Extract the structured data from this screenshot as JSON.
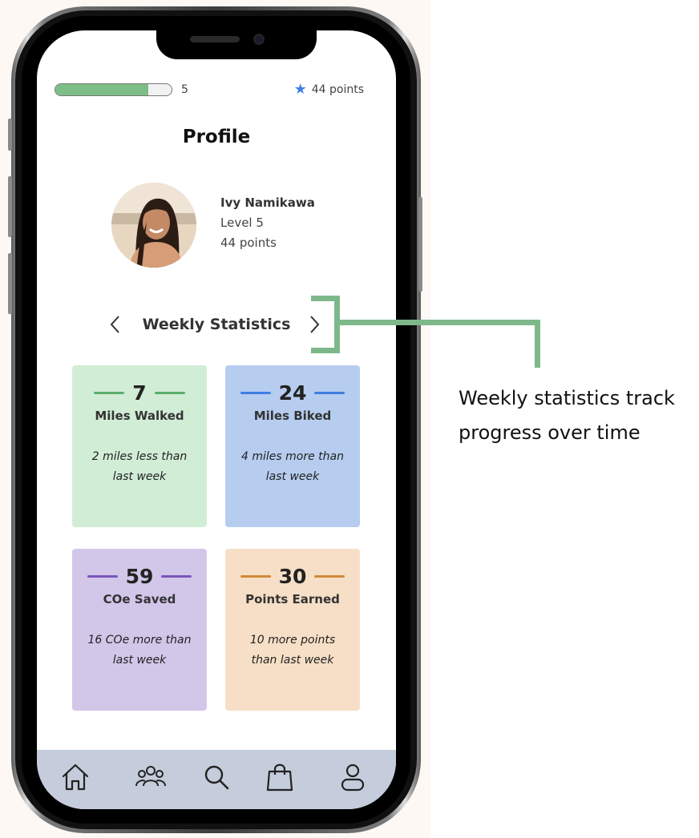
{
  "status": {
    "level": "5",
    "level_progress_percent": 80,
    "points": "44 points"
  },
  "page": {
    "title": "Profile"
  },
  "user": {
    "name": "Ivy Namikawa",
    "level": "Level 5",
    "points": "44 points"
  },
  "stats": {
    "header": "Weekly Statistics",
    "cards": [
      {
        "value": "7",
        "label": "Miles Walked",
        "desc": "2 miles less than last week",
        "accent": "#5aae6a",
        "bg": "#d1edd6"
      },
      {
        "value": "24",
        "label": "Miles Biked",
        "desc": "4 miles more than last week",
        "accent": "#3f7ee0",
        "bg": "#b6cdf0"
      },
      {
        "value": "59",
        "label": "COe Saved",
        "desc": "16 COe more than last week",
        "accent": "#7a56b8",
        "bg": "#d2c6e9"
      },
      {
        "value": "30",
        "label": "Points Earned",
        "desc": "10 more points than last week",
        "accent": "#d08a38",
        "bg": "#f6dfc6"
      }
    ]
  },
  "nav": {
    "items": [
      {
        "icon": "home-icon"
      },
      {
        "icon": "community-icon"
      },
      {
        "icon": "search-icon"
      },
      {
        "icon": "shopping-bag-icon"
      },
      {
        "icon": "profile-icon"
      }
    ],
    "bg": "#c5ccdb"
  },
  "annotation": {
    "text": "Weekly statistics track progress over time",
    "color": "#7eb88a"
  },
  "colors": {
    "progress_fill": "#7dbd86",
    "star": "#3f80e6"
  }
}
